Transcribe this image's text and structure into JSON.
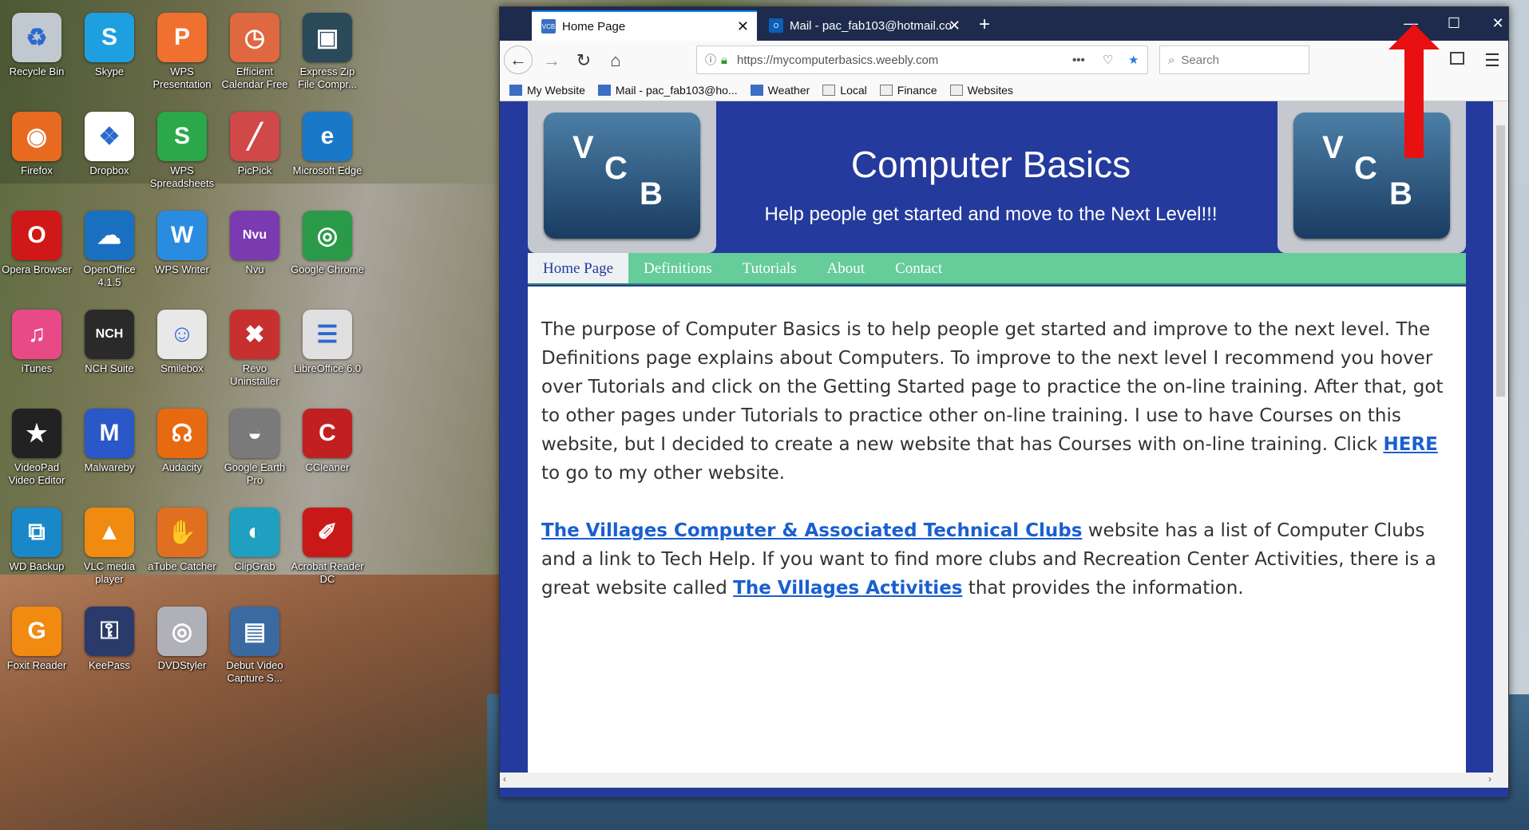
{
  "desktop": {
    "icons": [
      {
        "label": "Recycle Bin",
        "glyph": "♻",
        "color": "#c0c8d0"
      },
      {
        "label": "Skype",
        "glyph": "S",
        "color": "#1ea0e0"
      },
      {
        "label": "WPS Presentation",
        "glyph": "P",
        "color": "#f07030"
      },
      {
        "label": "Efficient Calendar Free",
        "glyph": "◷",
        "color": "#e06840"
      },
      {
        "label": "Express Zip File Compr...",
        "glyph": "▣",
        "color": "#2a4a5a"
      },
      {
        "label": "Firefox",
        "glyph": "◉",
        "color": "#e86a20"
      },
      {
        "label": "Dropbox",
        "glyph": "❖",
        "color": "#ffffff"
      },
      {
        "label": "WPS Spreadsheets",
        "glyph": "S",
        "color": "#2aa84a"
      },
      {
        "label": "PicPick",
        "glyph": "╱",
        "color": "#d04848"
      },
      {
        "label": "Microsoft Edge",
        "glyph": "e",
        "color": "#1a78c8"
      },
      {
        "label": "Opera Browser",
        "glyph": "O",
        "color": "#d01818"
      },
      {
        "label": "OpenOffice 4.1.5",
        "glyph": "☁",
        "color": "#1a70c0"
      },
      {
        "label": "WPS Writer",
        "glyph": "W",
        "color": "#2a8ce0"
      },
      {
        "label": "Nvu",
        "glyph": "Nvu",
        "color": "#7a3ab0"
      },
      {
        "label": "Google Chrome",
        "glyph": "◎",
        "color": "#2a9a48"
      },
      {
        "label": "iTunes",
        "glyph": "♫",
        "color": "#e84a88"
      },
      {
        "label": "NCH Suite",
        "glyph": "NCH",
        "color": "#2a2a2a"
      },
      {
        "label": "Smilebox",
        "glyph": "☺",
        "color": "#e8e8e8"
      },
      {
        "label": "Revo Uninstaller",
        "glyph": "✖",
        "color": "#c83030"
      },
      {
        "label": "LibreOffice 6.0",
        "glyph": "☰",
        "color": "#e0e0e0"
      },
      {
        "label": "VideoPad Video Editor",
        "glyph": "★",
        "color": "#222222"
      },
      {
        "label": "Malwareby",
        "glyph": "M",
        "color": "#2a58c8"
      },
      {
        "label": "Audacity",
        "glyph": "☊",
        "color": "#e86a10"
      },
      {
        "label": "Google Earth Pro",
        "glyph": "◒",
        "color": "#7a7a7a"
      },
      {
        "label": "CCleaner",
        "glyph": "C",
        "color": "#c02020"
      },
      {
        "label": "WD Backup",
        "glyph": "⧉",
        "color": "#1a88c8"
      },
      {
        "label": "VLC media player",
        "glyph": "▲",
        "color": "#f08a10"
      },
      {
        "label": "aTube Catcher",
        "glyph": "✋",
        "color": "#e07020"
      },
      {
        "label": "ClipGrab",
        "glyph": "◐",
        "color": "#20a0c0"
      },
      {
        "label": "Acrobat Reader DC",
        "glyph": "✐",
        "color": "#c81818"
      },
      {
        "label": "Foxit Reader",
        "glyph": "G",
        "color": "#f08a10"
      },
      {
        "label": "KeePass",
        "glyph": "⚿",
        "color": "#2a3a6a"
      },
      {
        "label": "DVDStyler",
        "glyph": "◎",
        "color": "#b0b0b8"
      },
      {
        "label": "Debut Video Capture S...",
        "glyph": "▤",
        "color": "#3a6aa0"
      }
    ]
  },
  "browser": {
    "tabs": [
      {
        "label": "Home Page",
        "favicon": "VCB"
      },
      {
        "label": "Mail - pac_fab103@hotmail.co",
        "favicon": "O"
      }
    ],
    "new_tab": "+",
    "window_controls": {
      "minimize": "—",
      "maximize": "☐",
      "close": "✕"
    },
    "nav": {
      "back": "←",
      "forward": "→",
      "reload": "↻",
      "home": "⌂"
    },
    "url": "https://mycomputerbasics.weebly.com",
    "url_actions": "•••",
    "search_placeholder": "Search",
    "menu_icon": "☰",
    "bookmarks": [
      {
        "label": "My Website",
        "type": "site"
      },
      {
        "label": "Mail - pac_fab103@ho...",
        "type": "site"
      },
      {
        "label": "Weather",
        "type": "site"
      },
      {
        "label": "Local",
        "type": "folder"
      },
      {
        "label": "Finance",
        "type": "folder"
      },
      {
        "label": "Websites",
        "type": "folder"
      }
    ]
  },
  "site": {
    "logo_letters": {
      "v": "V",
      "c": "C",
      "b": "B"
    },
    "title": "Computer Basics",
    "tagline": "Help people get started and move to the Next Level!!!",
    "menu": [
      "Home Page",
      "Definitions",
      "Tutorials",
      "About",
      "Contact"
    ],
    "paragraph1_text": "The purpose of Computer Basics is to help people get started and improve to the next level.  The Definitions page explains about Computers.  To improve to the next level I recommend you hover over Tutorials and click on the Getting Started page to practice the on-line training.  After that, got to other pages under Tutorials to practice other on-line training.  I use to have Courses on this website, but I decided to create a new website that has Courses with on-line training.  Click ",
    "paragraph1_link": "HERE",
    "paragraph1_tail": " to go to my other website.",
    "paragraph2_link1": "The Villages Computer & Associated Technical Clubs",
    "paragraph2_mid": " website has a list of Computer Clubs and a link to Tech Help.  If you want to find more clubs and Recreation Center Activities, there is a great website called ",
    "paragraph2_link2": "The Villages Activities",
    "paragraph2_tail": " that provides the information."
  },
  "annotation": {
    "arrow_color": "#e81010"
  }
}
